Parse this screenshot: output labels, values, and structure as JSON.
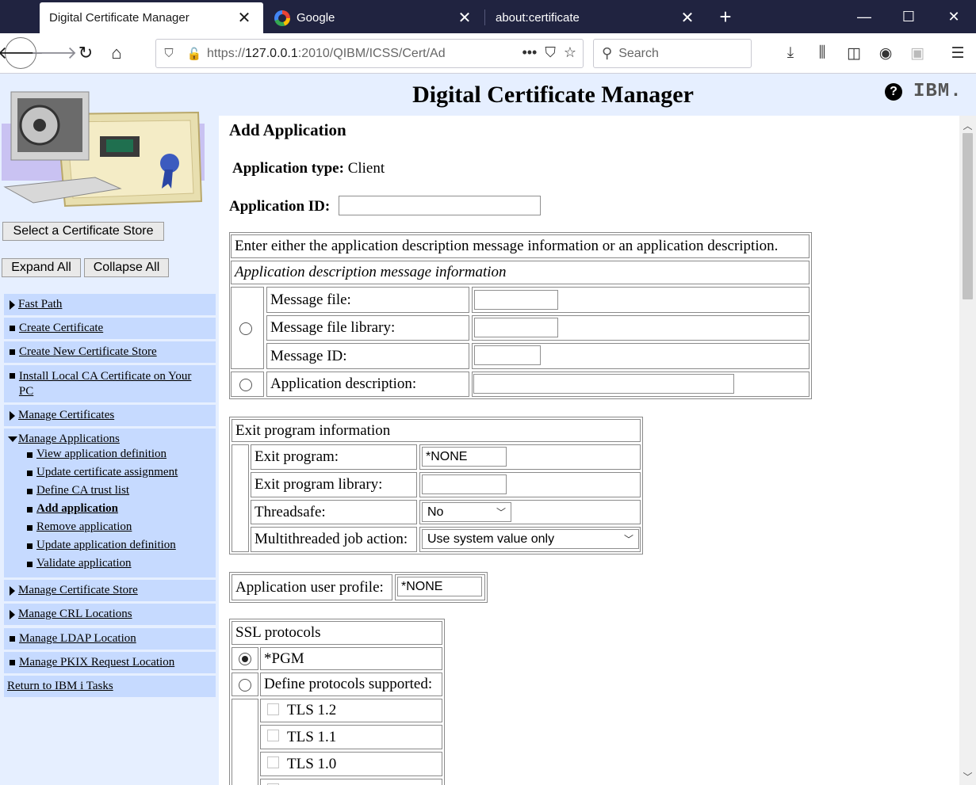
{
  "browser": {
    "tabs": [
      {
        "title": "Digital Certificate Manager",
        "active": true
      },
      {
        "title": "Google",
        "active": false
      },
      {
        "title": "about:certificate",
        "active": false
      }
    ],
    "url_prefix": "https://",
    "url_host": "127.0.0.1",
    "url_rest": ":2010/QIBM/ICSS/Cert/Ad",
    "url_menu": "•••",
    "search_placeholder": "Search"
  },
  "header": {
    "title": "Digital Certificate Manager",
    "help": "?",
    "logo": "IBM."
  },
  "leftnav": {
    "select_store": "Select a Certificate Store",
    "expand_all": "Expand All",
    "collapse_all": "Collapse All",
    "items": {
      "fast_path": "Fast Path",
      "create_certificate": "Create Certificate",
      "create_store": "Create New Certificate Store",
      "install_ca": "Install Local CA Certificate on Your PC",
      "manage_certificates": "Manage Certificates",
      "manage_applications": "Manage Applications",
      "manage_store": "Manage Certificate Store",
      "manage_crl": "Manage CRL Locations",
      "manage_ldap": "Manage LDAP Location",
      "manage_pkix": "Manage PKIX Request Location"
    },
    "sub_items": {
      "view_definition": "View application definition",
      "update_assignment": "Update certificate assignment",
      "define_ca_trust": "Define CA trust list",
      "add_application": "Add application",
      "remove_application": "Remove application",
      "update_definition": "Update application definition",
      "validate_application": "Validate application"
    },
    "return_link": "Return to IBM i Tasks"
  },
  "main": {
    "heading": "Add Application",
    "app_type_label": "Application type:",
    "app_type_value": "Client",
    "app_id_label": "Application ID:",
    "app_id_value": "",
    "desc_instruction": "Enter either the application description message information or an application description.",
    "desc_msg_heading": "Application description message information",
    "message_file_label": "Message file:",
    "message_file_library_label": "Message file library:",
    "message_id_label": "Message ID:",
    "app_description_label": "Application description:",
    "exit_heading": "Exit program information",
    "exit_program_label": "Exit program:",
    "exit_program_value": "*NONE",
    "exit_program_library_label": "Exit program library:",
    "threadsafe_label": "Threadsafe:",
    "threadsafe_value": "No",
    "multithreaded_label": "Multithreaded job action:",
    "multithreaded_value": "Use system value only",
    "user_profile_label": "Application user profile:",
    "user_profile_value": "*NONE",
    "ssl_heading": "SSL protocols",
    "ssl_pgm": "*PGM",
    "ssl_define": "Define protocols supported:",
    "ssl_options": [
      "TLS 1.2",
      "TLS 1.1",
      "TLS 1.0"
    ]
  }
}
